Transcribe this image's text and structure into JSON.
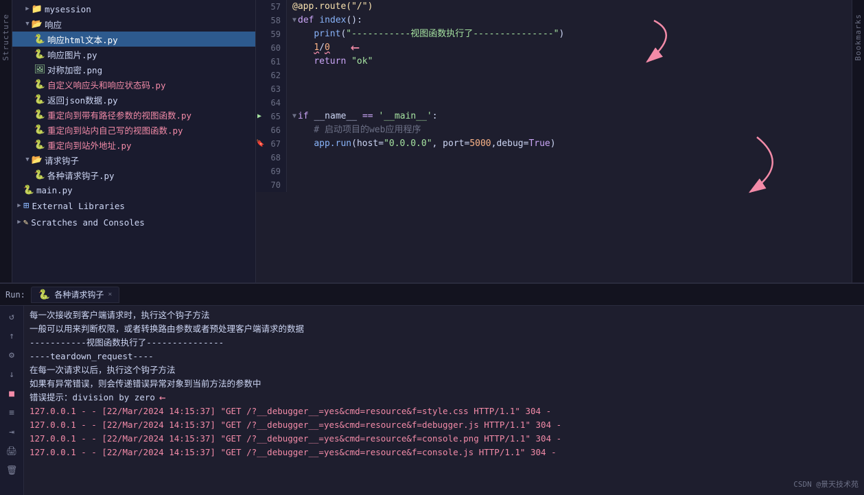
{
  "sidebar": {
    "items": [
      {
        "id": "mysession",
        "label": "mysession",
        "type": "folder",
        "indent": 1,
        "expanded": false
      },
      {
        "id": "yingying",
        "label": "响应",
        "type": "folder",
        "indent": 1,
        "expanded": true
      },
      {
        "id": "yingying-html",
        "label": "响应html文本.py",
        "type": "py",
        "indent": 2,
        "selected": true
      },
      {
        "id": "yingying-img",
        "label": "响应图片.py",
        "type": "py",
        "indent": 2
      },
      {
        "id": "duicheng",
        "label": "对称加密.png",
        "type": "png",
        "indent": 2
      },
      {
        "id": "zidingyi",
        "label": "自定义响应头和响应状态码.py",
        "type": "py-red",
        "indent": 2
      },
      {
        "id": "fanhuijson",
        "label": "返回json数据.py",
        "type": "py",
        "indent": 2
      },
      {
        "id": "zhongdao1",
        "label": "重定向到带有路径参数的视图函数.py",
        "type": "py-red",
        "indent": 2
      },
      {
        "id": "zhongdao2",
        "label": "重定向到站内自己写的视图函数.py",
        "type": "py-red",
        "indent": 2
      },
      {
        "id": "zhongdao3",
        "label": "重定向到站外地址.py",
        "type": "py-red",
        "indent": 2
      },
      {
        "id": "qiugouz",
        "label": "请求钩子",
        "type": "folder",
        "indent": 1,
        "expanded": true
      },
      {
        "id": "gezi",
        "label": "各种请求钩子.py",
        "type": "py",
        "indent": 2
      },
      {
        "id": "main",
        "label": "main.py",
        "type": "py",
        "indent": 1
      },
      {
        "id": "external",
        "label": "External Libraries",
        "type": "lib",
        "indent": 0
      },
      {
        "id": "scratches",
        "label": "Scratches and Consoles",
        "type": "scratch",
        "indent": 0
      }
    ]
  },
  "code": {
    "lines": [
      {
        "num": 57,
        "content": "@app.route(\"/\")",
        "type": "decorator"
      },
      {
        "num": 58,
        "content": "def index():",
        "type": "def"
      },
      {
        "num": 59,
        "content": "    print(\"-----------视图函数执行了---------------\")",
        "type": "normal"
      },
      {
        "num": 60,
        "content": "    1/0",
        "type": "error-line",
        "has_arrow": true
      },
      {
        "num": 61,
        "content": "    return \"ok\"",
        "type": "return"
      },
      {
        "num": 62,
        "content": "",
        "type": "empty"
      },
      {
        "num": 63,
        "content": "",
        "type": "empty"
      },
      {
        "num": 64,
        "content": "",
        "type": "empty"
      },
      {
        "num": 65,
        "content": "if __name__ == '__main__':",
        "type": "if",
        "has_run": true
      },
      {
        "num": 66,
        "content": "    # 启动项目的web应用程序",
        "type": "comment"
      },
      {
        "num": 67,
        "content": "    app.run(host=\"0.0.0.0\", port=5000,debug=True)",
        "type": "run",
        "has_bookmark": true
      },
      {
        "num": 68,
        "content": "",
        "type": "empty"
      },
      {
        "num": 69,
        "content": "",
        "type": "empty"
      },
      {
        "num": 70,
        "content": "",
        "type": "empty"
      }
    ]
  },
  "run_panel": {
    "label": "Run:",
    "tab_label": "各种请求钩子",
    "tab_close": "×",
    "console_lines": [
      {
        "text": "每一次接收到客户端请求时，执行这个钩子方法",
        "type": "normal"
      },
      {
        "text": "一般可以用来判断权限，或者转换路由参数或者预处理客户端请求的数据",
        "type": "normal"
      },
      {
        "text": "-----------视图函数执行了---------------",
        "type": "normal"
      },
      {
        "text": "----teardown_request----",
        "type": "normal"
      },
      {
        "text": "在每一次请求以后，执行这个钩子方法",
        "type": "normal"
      },
      {
        "text": "如果有异常错误，则会传递错误异常对象到当前方法的参数中",
        "type": "normal"
      },
      {
        "text": "错误提示：division by zero",
        "type": "error-arrow"
      },
      {
        "text": "127.0.0.1 - - [22/Mar/2024 14:15:37] \"GET /?__debugger__=yes&cmd=resource&f=style.css HTTP/1.1\" 304 -",
        "type": "red"
      },
      {
        "text": "127.0.0.1 - - [22/Mar/2024 14:15:37] \"GET /?__debugger__=yes&cmd=resource&f=debugger.js HTTP/1.1\" 304 -",
        "type": "red"
      },
      {
        "text": "127.0.0.1 - - [22/Mar/2024 14:15:37] \"GET /?__debugger__=yes&cmd=resource&f=console.png HTTP/1.1\" 304 -",
        "type": "red"
      },
      {
        "text": "127.0.0.1 - - [22/Mar/2024 14:15:37] \"GET /?__debugger__=yes&cmd=resource&f=console.js HTTP/1.1\" 304 -",
        "type": "red"
      }
    ]
  },
  "watermark": "CSDN @景天技术苑",
  "structure_label": "Structure",
  "bookmarks_label": "Bookmarks"
}
